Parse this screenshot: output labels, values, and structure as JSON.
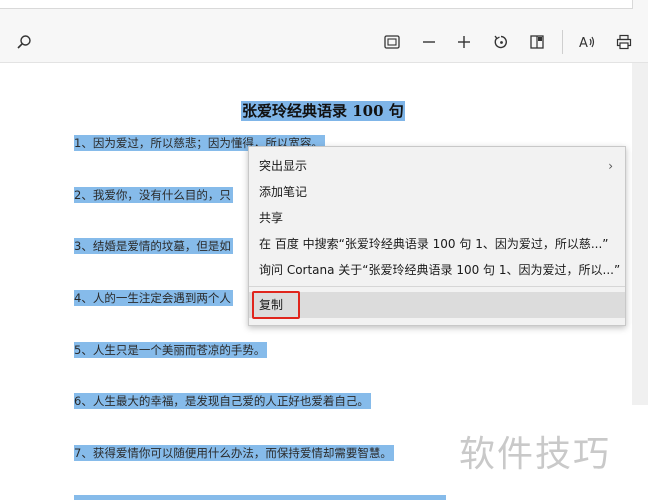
{
  "toolbar": {
    "icons": [
      "search-icon",
      "fit-page-icon",
      "zoom-out-icon",
      "zoom-in-icon",
      "rotate-icon",
      "page-view-icon",
      "read-aloud-icon",
      "print-icon"
    ]
  },
  "document": {
    "title": "张爱玲经典语录 100 句",
    "lines": [
      "1、因为爱过，所以慈悲；因为懂得，所以宽容。",
      "2、我爱你，没有什么目的，只",
      "3、结婚是爱情的坟墓，但是如",
      "4、人的一生注定会遇到两个人",
      "5、人生只是一个美丽而苍凉的手势。",
      "6、人生最大的幸福，是发现自己爱的人正好也爱着自己。",
      "7、获得爱情你可以随便用什么办法，而保持爱情却需要智慧。"
    ]
  },
  "context_menu": {
    "items": [
      {
        "label": "突出显示",
        "has_submenu": true
      },
      {
        "label": "添加笔记"
      },
      {
        "label": "共享"
      },
      {
        "label": "在 百度 中搜索“张爱玲经典语录 100 句 1、因为爱过，所以慈...”"
      },
      {
        "label": "询问 Cortana 关于“张爱玲经典语录 100 句 1、因为爱过，所以...”"
      },
      {
        "label": "复制"
      }
    ],
    "submenu_arrow": "›"
  },
  "watermark": "软件技巧",
  "colors": {
    "selection": "#86bbea",
    "highlight_box": "#e0251c",
    "menu_bg": "#f2f2f2"
  }
}
